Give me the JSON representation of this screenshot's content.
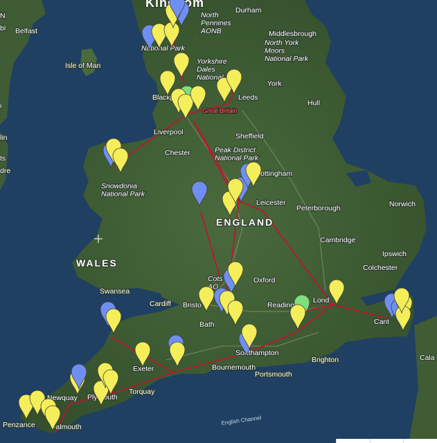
{
  "map": {
    "labels": {
      "kingdom": "Kingdom",
      "north_pennines": "North\nPennines\nAONB",
      "durham": "Durham",
      "middlesbrough": "Middlesbrough",
      "north_york_moors": "North York\nMoors\nNational Park",
      "belfast": "Belfast",
      "isle_of_man": "Isle of Man",
      "lake_district": "National Park",
      "yorkshire_dales": "Yorkshire\nDales\nNational Park",
      "york": "York",
      "leeds": "Leeds",
      "blackpool": "Blackp",
      "hull": "Hull",
      "great_britain": "Great Britain",
      "liverpool": "Liverpool",
      "sheffield": "Sheffield",
      "chester": "Chester",
      "peak_district": "Peak District\nNational Park",
      "nottingham": "ottingham",
      "snowdonia": "Snowdonia\nNational Park",
      "leicester": "Leicester",
      "peterborough": "Peterborough",
      "norwich": "Norwich",
      "england": "ENGLAND",
      "cambridge": "Cambridge",
      "ipswich": "Ipswich",
      "wales": "WALES",
      "colchester": "Colchester",
      "cotswolds": "Cots\nAO",
      "oxford": "Oxford",
      "swansea": "Swansea",
      "london": "Lond",
      "cardiff": "Cardiff",
      "bristol": "Bristo",
      "reading": "Reading",
      "canterbury": "Cant",
      "bath": "Bath",
      "southampton": "Southampton",
      "exeter": "Exeter",
      "brighton": "Brighton",
      "bournemouth": "Bournemouth",
      "portsmouth": "Portsmouth",
      "torquay": "Torquay",
      "newquay": "Newquay",
      "plymouth": "Plymouth",
      "penzance": "Penzance",
      "falmouth": "Falmouth",
      "english_channel": "English Channel",
      "calais": "Cala",
      "n_left": "N",
      "bl_left": "bl",
      "i_left": "i",
      "lin_left": "lin",
      "ts_left": "ts",
      "dre_left": "dre"
    },
    "colors": {
      "sea": "#1f3f63",
      "land": "#3d5a33",
      "route": "#c8102e",
      "pin_yellow": "#f4ee5a",
      "pin_blue": "#6f8ff0",
      "pin_green": "#7ee07c"
    },
    "marker_legend": {
      "yellow": "yellow pin",
      "blue": "blue pin",
      "green": "green pin"
    },
    "attribution_bar": ""
  }
}
